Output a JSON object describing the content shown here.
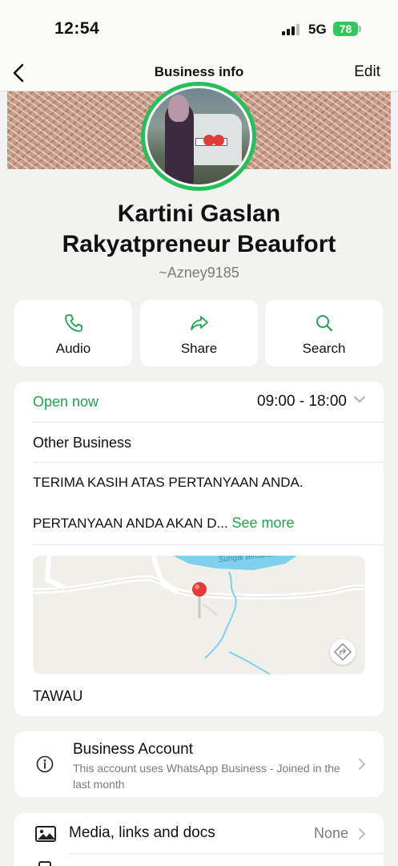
{
  "status_bar": {
    "time": "12:54",
    "network": "5G",
    "battery": "78"
  },
  "nav": {
    "title": "Business info",
    "edit_label": "Edit"
  },
  "profile": {
    "name_line1": "Kartini Gaslan",
    "name_line2": "Rakyatpreneur Beaufort",
    "handle": "~Azney9185"
  },
  "actions": [
    {
      "label": "Audio",
      "icon": "phone-icon"
    },
    {
      "label": "Share",
      "icon": "share-icon"
    },
    {
      "label": "Search",
      "icon": "search-icon"
    }
  ],
  "business": {
    "open_status": "Open now",
    "hours": "09:00 - 18:00",
    "category": "Other Business",
    "description_line1": "TERIMA KASIH ATAS PERTANYAAN ANDA.",
    "description_line2": "PERTANYAAN ANDA AKAN D...",
    "see_more": "See more",
    "map_label": "Sungai Binsuluk",
    "location": "TAWAU"
  },
  "account": {
    "title": "Business Account",
    "subtitle": "This account uses WhatsApp Business - Joined in the last month"
  },
  "media": {
    "label": "Media, links and docs",
    "count": "None"
  },
  "colors": {
    "accent_green": "#21a34f",
    "ring_green": "#25c05a",
    "background": "#f2f2f0"
  }
}
